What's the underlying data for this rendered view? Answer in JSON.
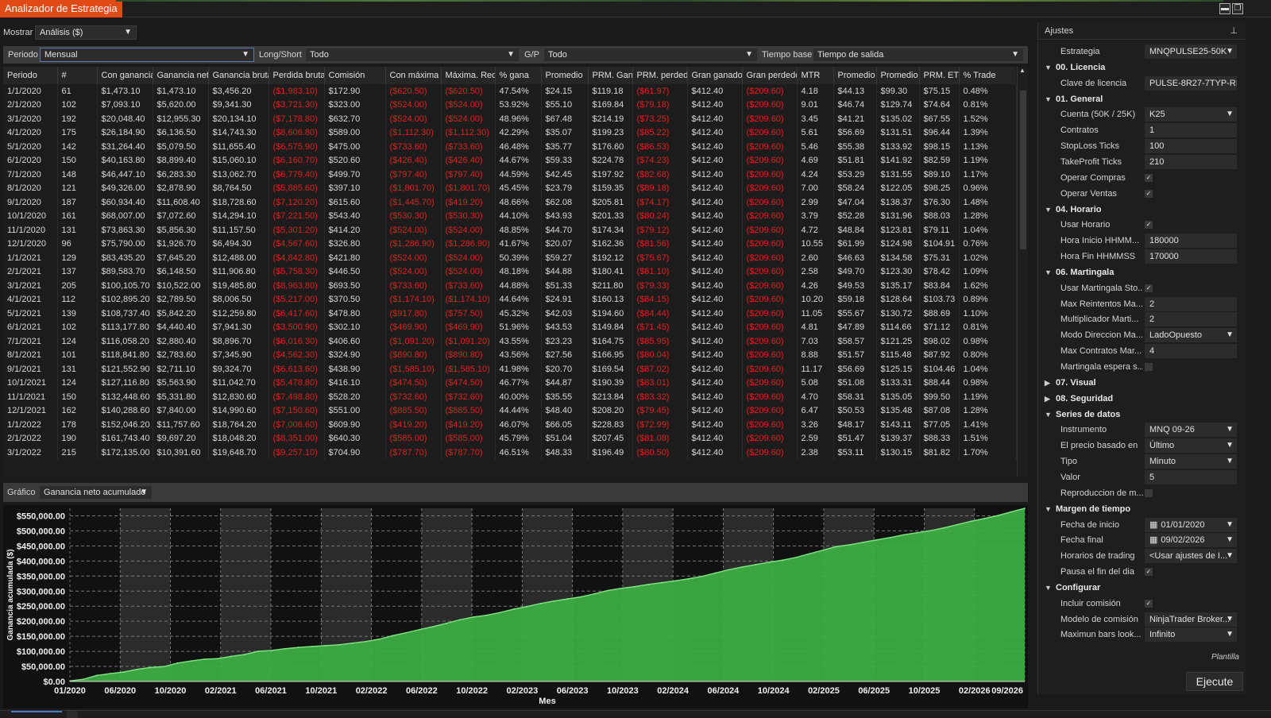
{
  "window": {
    "title": "Analizador de Estrategia"
  },
  "toolbar": {
    "mostrar_label": "Mostrar",
    "mostrar_value": "Análisis ($)"
  },
  "filters": {
    "periodo_label": "Periodo",
    "periodo_value": "Mensual",
    "longshort_label": "Long/Short",
    "longshort_value": "Todo",
    "gp_label": "G/P",
    "gp_value": "Todo",
    "tiempo_label": "Tiempo base",
    "tiempo_value": "Tiempo de salida"
  },
  "table": {
    "columns": [
      "Periodo",
      "#",
      "Con ganancia",
      "Ganancia neta",
      "Ganancia bruta",
      "Perdida bruta",
      "Comisión",
      "Con máxima",
      "Máxima. Redu",
      "% gana",
      "Promedio",
      "PRM. Gana",
      "PRM. perded",
      "Gran ganado",
      "Gran perdedo",
      "MTR",
      "Promedio",
      "Promedio",
      "PRM. ETD",
      "% Trade"
    ],
    "neg_cols": [
      5,
      7,
      8,
      12,
      14
    ],
    "rows": [
      [
        "1/1/2020",
        "61",
        "$1,473.10",
        "$1,473.10",
        "$3,456.20",
        "($1,983.10)",
        "$172.90",
        "($620.50)",
        "($620.50)",
        "47.54%",
        "$24.15",
        "$119.18",
        "($61.97)",
        "$412.40",
        "($209.60)",
        "4.18",
        "$44.13",
        "$99.30",
        "$75.15",
        "0.48%"
      ],
      [
        "2/1/2020",
        "102",
        "$7,093.10",
        "$5,620.00",
        "$9,341.30",
        "($3,721.30)",
        "$323.00",
        "($524.00)",
        "($524.00)",
        "53.92%",
        "$55.10",
        "$169.84",
        "($79.18)",
        "$412.40",
        "($209.60)",
        "9.01",
        "$46.74",
        "$129.74",
        "$74.64",
        "0.81%"
      ],
      [
        "3/1/2020",
        "192",
        "$20,048.40",
        "$12,955.30",
        "$20,134.10",
        "($7,178.80)",
        "$632.70",
        "($524.00)",
        "($524.00)",
        "48.96%",
        "$67.48",
        "$214.19",
        "($73.25)",
        "$412.40",
        "($209.60)",
        "3.45",
        "$41.21",
        "$135.02",
        "$67.55",
        "1.52%"
      ],
      [
        "4/1/2020",
        "175",
        "$26,184.90",
        "$6,136.50",
        "$14,743.30",
        "($8,606.80)",
        "$589.00",
        "($1,112.30)",
        "($1,112.30)",
        "42.29%",
        "$35.07",
        "$199.23",
        "($85.22)",
        "$412.40",
        "($209.60)",
        "5.61",
        "$56.69",
        "$131.51",
        "$96.44",
        "1.39%"
      ],
      [
        "5/1/2020",
        "142",
        "$31,264.40",
        "$5,079.50",
        "$11,655.40",
        "($6,575.90)",
        "$475.00",
        "($733.60)",
        "($733.60)",
        "46.48%",
        "$35.77",
        "$176.60",
        "($86.53)",
        "$412.40",
        "($209.60)",
        "5.46",
        "$55.38",
        "$133.92",
        "$98.15",
        "1.13%"
      ],
      [
        "6/1/2020",
        "150",
        "$40,163.80",
        "$8,899.40",
        "$15,060.10",
        "($6,160.70)",
        "$520.60",
        "($426.40)",
        "($426.40)",
        "44.67%",
        "$59.33",
        "$224.78",
        "($74.23)",
        "$412.40",
        "($209.60)",
        "4.69",
        "$51.81",
        "$141.92",
        "$82.59",
        "1.19%"
      ],
      [
        "7/1/2020",
        "148",
        "$46,447.10",
        "$6,283.30",
        "$13,062.70",
        "($6,779.40)",
        "$499.70",
        "($797.40)",
        "($797.40)",
        "44.59%",
        "$42.45",
        "$197.92",
        "($82.68)",
        "$412.40",
        "($209.60)",
        "4.24",
        "$53.29",
        "$131.55",
        "$89.10",
        "1.17%"
      ],
      [
        "8/1/2020",
        "121",
        "$49,326.00",
        "$2,878.90",
        "$8,764.50",
        "($5,885.60)",
        "$397.10",
        "($1,801.70)",
        "($1,801.70)",
        "45.45%",
        "$23.79",
        "$159.35",
        "($89.18)",
        "$412.40",
        "($209.60)",
        "7.00",
        "$58.24",
        "$122.05",
        "$98.25",
        "0.96%"
      ],
      [
        "9/1/2020",
        "187",
        "$60,934.40",
        "$11,608.40",
        "$18,728.60",
        "($7,120.20)",
        "$615.60",
        "($1,445.70)",
        "($419.20)",
        "48.66%",
        "$62.08",
        "$205.81",
        "($74.17)",
        "$412.40",
        "($209.60)",
        "2.99",
        "$47.04",
        "$138.37",
        "$76.30",
        "1.48%"
      ],
      [
        "10/1/2020",
        "161",
        "$68,007.00",
        "$7,072.60",
        "$14,294.10",
        "($7,221.50)",
        "$543.40",
        "($530.30)",
        "($530.30)",
        "44.10%",
        "$43.93",
        "$201.33",
        "($80.24)",
        "$412.40",
        "($209.60)",
        "3.79",
        "$52.28",
        "$131.96",
        "$88.03",
        "1.28%"
      ],
      [
        "11/1/2020",
        "131",
        "$73,863.30",
        "$5,856.30",
        "$11,157.50",
        "($5,301.20)",
        "$414.20",
        "($524.00)",
        "($524.00)",
        "48.85%",
        "$44.70",
        "$174.34",
        "($79.12)",
        "$412.40",
        "($209.60)",
        "4.72",
        "$48.84",
        "$123.81",
        "$79.11",
        "1.04%"
      ],
      [
        "12/1/2020",
        "96",
        "$75,790.00",
        "$1,926.70",
        "$6,494.30",
        "($4,567.60)",
        "$326.80",
        "($1,286.90)",
        "($1,286.90)",
        "41.67%",
        "$20.07",
        "$162.36",
        "($81.56)",
        "$412.40",
        "($209.60)",
        "10.55",
        "$61.99",
        "$124.98",
        "$104.91",
        "0.76%"
      ],
      [
        "1/1/2021",
        "129",
        "$83,435.20",
        "$7,645.20",
        "$12,488.00",
        "($4,842.80)",
        "$421.80",
        "($524.00)",
        "($524.00)",
        "50.39%",
        "$59.27",
        "$192.12",
        "($75.67)",
        "$412.40",
        "($209.60)",
        "2.60",
        "$46.63",
        "$134.58",
        "$75.31",
        "1.02%"
      ],
      [
        "2/1/2021",
        "137",
        "$89,583.70",
        "$6,148.50",
        "$11,906.80",
        "($5,758.30)",
        "$446.50",
        "($524.00)",
        "($524.00)",
        "48.18%",
        "$44.88",
        "$180.41",
        "($81.10)",
        "$412.40",
        "($209.60)",
        "2.58",
        "$49.70",
        "$123.30",
        "$78.42",
        "1.09%"
      ],
      [
        "3/1/2021",
        "205",
        "$100,105.70",
        "$10,522.00",
        "$19,485.80",
        "($8,963.80)",
        "$693.50",
        "($733.60)",
        "($733.60)",
        "44.88%",
        "$51.33",
        "$211.80",
        "($79.33)",
        "$412.40",
        "($209.60)",
        "4.26",
        "$49.53",
        "$135.17",
        "$83.84",
        "1.62%"
      ],
      [
        "4/1/2021",
        "112",
        "$102,895.20",
        "$2,789.50",
        "$8,006.50",
        "($5,217.00)",
        "$370.50",
        "($1,174.10)",
        "($1,174.10)",
        "44.64%",
        "$24.91",
        "$160.13",
        "($84.15)",
        "$412.40",
        "($209.60)",
        "10.20",
        "$59.18",
        "$128.64",
        "$103.73",
        "0.89%"
      ],
      [
        "5/1/2021",
        "139",
        "$108,737.40",
        "$5,842.20",
        "$12,259.80",
        "($6,417.60)",
        "$478.80",
        "($917.80)",
        "($757.50)",
        "45.32%",
        "$42.03",
        "$194.60",
        "($84.44)",
        "$412.40",
        "($209.60)",
        "11.05",
        "$55.67",
        "$130.72",
        "$88.69",
        "1.10%"
      ],
      [
        "6/1/2021",
        "102",
        "$113,177.80",
        "$4,440.40",
        "$7,941.30",
        "($3,500.90)",
        "$302.10",
        "($469.90)",
        "($469.90)",
        "51.96%",
        "$43.53",
        "$149.84",
        "($71.45)",
        "$412.40",
        "($209.60)",
        "4.81",
        "$47.89",
        "$114.66",
        "$71.12",
        "0.81%"
      ],
      [
        "7/1/2021",
        "124",
        "$116,058.20",
        "$2,880.40",
        "$8,896.70",
        "($6,016.30)",
        "$406.60",
        "($1,091.20)",
        "($1,091.20)",
        "43.55%",
        "$23.23",
        "$164.75",
        "($85.95)",
        "$412.40",
        "($209.60)",
        "7.03",
        "$58.57",
        "$121.25",
        "$98.02",
        "0.98%"
      ],
      [
        "8/1/2021",
        "101",
        "$118,841.80",
        "$2,783.60",
        "$7,345.90",
        "($4,562.30)",
        "$324.90",
        "($890.80)",
        "($890.80)",
        "43.56%",
        "$27.56",
        "$166.95",
        "($80.04)",
        "$412.40",
        "($209.60)",
        "8.88",
        "$51.57",
        "$115.48",
        "$87.92",
        "0.80%"
      ],
      [
        "9/1/2021",
        "131",
        "$121,552.90",
        "$2,711.10",
        "$9,324.70",
        "($6,613.60)",
        "$438.90",
        "($1,585.10)",
        "($1,585.10)",
        "41.98%",
        "$20.70",
        "$169.54",
        "($87.02)",
        "$412.40",
        "($209.60)",
        "11.17",
        "$56.69",
        "$125.15",
        "$104.46",
        "1.04%"
      ],
      [
        "10/1/2021",
        "124",
        "$127,116.80",
        "$5,563.90",
        "$11,042.70",
        "($5,478.80)",
        "$416.10",
        "($474.50)",
        "($474.50)",
        "46.77%",
        "$44.87",
        "$190.39",
        "($83.01)",
        "$412.40",
        "($209.60)",
        "5.08",
        "$51.08",
        "$133.31",
        "$88.44",
        "0.98%"
      ],
      [
        "11/1/2021",
        "150",
        "$132,448.60",
        "$5,331.80",
        "$12,830.60",
        "($7,498.80)",
        "$528.20",
        "($732.60)",
        "($732.60)",
        "40.00%",
        "$35.55",
        "$213.84",
        "($83.32)",
        "$412.40",
        "($209.60)",
        "4.70",
        "$58.31",
        "$135.05",
        "$99.50",
        "1.19%"
      ],
      [
        "12/1/2021",
        "162",
        "$140,288.60",
        "$7,840.00",
        "$14,990.60",
        "($7,150.60)",
        "$551.00",
        "($885.50)",
        "($885.50)",
        "44.44%",
        "$48.40",
        "$208.20",
        "($79.45)",
        "$412.40",
        "($209.60)",
        "6.47",
        "$50.53",
        "$135.48",
        "$87.08",
        "1.28%"
      ],
      [
        "1/1/2022",
        "178",
        "$152,046.20",
        "$11,757.60",
        "$18,764.20",
        "($7,006.60)",
        "$609.90",
        "($419.20)",
        "($419.20)",
        "46.07%",
        "$66.05",
        "$228.83",
        "($72.99)",
        "$412.40",
        "($209.60)",
        "3.26",
        "$48.17",
        "$143.11",
        "$77.05",
        "1.41%"
      ],
      [
        "2/1/2022",
        "190",
        "$161,743.40",
        "$9,697.20",
        "$18,048.20",
        "($8,351.00)",
        "$640.30",
        "($585.00)",
        "($585.00)",
        "45.79%",
        "$51.04",
        "$207.45",
        "($81.08)",
        "$412.40",
        "($209.60)",
        "2.59",
        "$51.47",
        "$139.37",
        "$88.33",
        "1.51%"
      ],
      [
        "3/1/2022",
        "215",
        "$172,135.00",
        "$10,391.60",
        "$19,648.70",
        "($9,257.10)",
        "$704.90",
        "($787.70)",
        "($787.70)",
        "46.51%",
        "$48.33",
        "$196.49",
        "($80.50)",
        "$412.40",
        "($209.60)",
        "2.38",
        "$53.11",
        "$130.15",
        "$81.82",
        "1.70%"
      ]
    ]
  },
  "chart_panel": {
    "label": "Gráfico",
    "select_value": "Ganancia neto acumulado"
  },
  "chart_data": {
    "type": "area",
    "xlabel": "Mes",
    "ylabel": "Ganancia acumulada ($)",
    "ylim": [
      0,
      575000
    ],
    "yticks": [
      "$0.00",
      "$50,000.00",
      "$100,000.00",
      "$150,000.00",
      "$200,000.00",
      "$250,000.00",
      "$300,000.00",
      "$350,000.00",
      "$400,000.00",
      "$450,000.00",
      "$500,000.00",
      "$550,000.00"
    ],
    "xticks": [
      "01/2020",
      "06/2020",
      "10/2020",
      "02/2021",
      "06/2021",
      "10/2021",
      "02/2022",
      "06/2022",
      "10/2022",
      "02/2023",
      "06/2023",
      "10/2023",
      "02/2024",
      "06/2024",
      "10/2024",
      "02/2025",
      "06/2025",
      "10/2025",
      "02/2026",
      "09/2026"
    ],
    "grid": true,
    "color": "#3cb043",
    "values": [
      1473,
      7093,
      20048,
      26185,
      31264,
      40164,
      46447,
      49326,
      60934,
      68007,
      73863,
      75790,
      83435,
      89584,
      100106,
      102895,
      108737,
      113178,
      116058,
      118842,
      121553,
      127117,
      132449,
      140289,
      152046,
      161743,
      172135,
      182000,
      193000,
      205000,
      214000,
      220000,
      229000,
      240000,
      249000,
      259000,
      267000,
      274000,
      281000,
      291000,
      302000,
      309000,
      315000,
      322000,
      328000,
      334000,
      341000,
      349000,
      360000,
      371000,
      380000,
      388000,
      396000,
      403000,
      412000,
      424000,
      436000,
      448000,
      454000,
      462000,
      470000,
      478000,
      487000,
      494000,
      501000,
      510000,
      521000,
      532000,
      541000,
      551000,
      563000,
      575000
    ]
  },
  "settings": {
    "header": "Ajustes",
    "items": [
      {
        "kind": "prop",
        "name": "Estrategia",
        "value": "MNQPULSE25-50K",
        "ctrl": "select"
      },
      {
        "kind": "cat",
        "name": "00. Licencia",
        "arrow": "▼"
      },
      {
        "kind": "prop",
        "name": "Clave de licencia",
        "value": "PULSE-8R27-7TYP-RH",
        "ctrl": "text"
      },
      {
        "kind": "cat",
        "name": "01. General",
        "arrow": "▼"
      },
      {
        "kind": "prop",
        "name": "Cuenta (50K / 25K)",
        "value": "K25",
        "ctrl": "select"
      },
      {
        "kind": "prop",
        "name": "Contratos",
        "value": "1",
        "ctrl": "text"
      },
      {
        "kind": "prop",
        "name": "StopLoss Ticks",
        "value": "100",
        "ctrl": "text"
      },
      {
        "kind": "prop",
        "name": "TakeProfit Ticks",
        "value": "210",
        "ctrl": "text"
      },
      {
        "kind": "prop",
        "name": "Operar Compras",
        "value": "✓",
        "ctrl": "check"
      },
      {
        "kind": "prop",
        "name": "Operar Ventas",
        "value": "✓",
        "ctrl": "check"
      },
      {
        "kind": "cat",
        "name": "04. Horario",
        "arrow": "▼"
      },
      {
        "kind": "prop",
        "name": "Usar Horario",
        "value": "✓",
        "ctrl": "check"
      },
      {
        "kind": "prop",
        "name": "Hora Inicio HHMM...",
        "value": "180000",
        "ctrl": "text"
      },
      {
        "kind": "prop",
        "name": "Hora Fin HHMMSS",
        "value": "170000",
        "ctrl": "text"
      },
      {
        "kind": "cat",
        "name": "06. Martingala",
        "arrow": "▼"
      },
      {
        "kind": "prop",
        "name": "Usar Martingala Sto...",
        "value": "✓",
        "ctrl": "check"
      },
      {
        "kind": "prop",
        "name": "Max Reintentos Ma...",
        "value": "2",
        "ctrl": "text"
      },
      {
        "kind": "prop",
        "name": "Multiplicador Marti...",
        "value": "2",
        "ctrl": "text"
      },
      {
        "kind": "prop",
        "name": "Modo Direccion Ma...",
        "value": "LadoOpuesto",
        "ctrl": "select"
      },
      {
        "kind": "prop",
        "name": "Max Contratos Mar...",
        "value": "4",
        "ctrl": "text"
      },
      {
        "kind": "prop",
        "name": "Martingala espera s...",
        "value": "",
        "ctrl": "check"
      },
      {
        "kind": "cat",
        "name": "07. Visual",
        "arrow": "▶"
      },
      {
        "kind": "cat",
        "name": "08. Seguridad",
        "arrow": "▶"
      },
      {
        "kind": "cat",
        "name": "Series de datos",
        "arrow": "▼"
      },
      {
        "kind": "prop",
        "name": "Instrumento",
        "value": "MNQ 09-26",
        "ctrl": "select"
      },
      {
        "kind": "prop",
        "name": "El precio basado en",
        "value": "Último",
        "ctrl": "select"
      },
      {
        "kind": "prop",
        "name": "Tipo",
        "value": "Minuto",
        "ctrl": "select"
      },
      {
        "kind": "prop",
        "name": "Valor",
        "value": "5",
        "ctrl": "text"
      },
      {
        "kind": "prop",
        "name": "Reproduccion de m...",
        "value": "",
        "ctrl": "check"
      },
      {
        "kind": "cat",
        "name": "Margen de tiempo",
        "arrow": "▼"
      },
      {
        "kind": "prop",
        "name": "Fecha de inicio",
        "value": "01/01/2020",
        "ctrl": "date"
      },
      {
        "kind": "prop",
        "name": "Fecha final",
        "value": "09/02/2026",
        "ctrl": "date"
      },
      {
        "kind": "prop",
        "name": "Horarios de trading",
        "value": "<Usar ajustes de I...",
        "ctrl": "select"
      },
      {
        "kind": "prop",
        "name": "Pausa el fin del dia",
        "value": "✓",
        "ctrl": "check"
      },
      {
        "kind": "cat",
        "name": "Configurar",
        "arrow": "▼"
      },
      {
        "kind": "prop",
        "name": "Incluir comisión",
        "value": "✓",
        "ctrl": "check"
      },
      {
        "kind": "prop",
        "name": "Modelo de comisión",
        "value": "NinjaTrader Broker...",
        "ctrl": "select"
      },
      {
        "kind": "prop",
        "name": "Maximun bars look...",
        "value": "Infinito",
        "ctrl": "select"
      }
    ],
    "plantilla": "Plantilla",
    "run_label": "Ejecute"
  }
}
